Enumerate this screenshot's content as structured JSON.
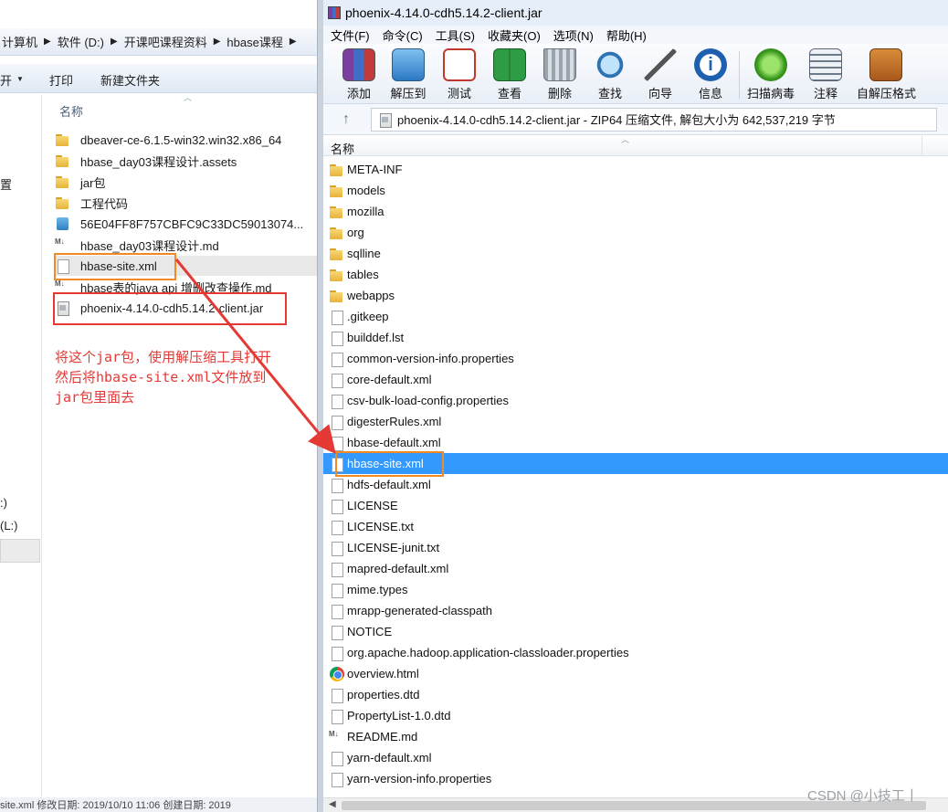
{
  "explorer": {
    "breadcrumbs": [
      "计算机",
      "软件 (D:)",
      "开课吧课程资料",
      "hbase课程"
    ],
    "commands": {
      "open_fragment": "开",
      "print": "打印",
      "new_folder": "新建文件夹"
    },
    "nav": {
      "item_settings": "置",
      "drive_partial_1": ":)",
      "drive_l": "(L:)"
    },
    "column_header": "名称",
    "files": [
      {
        "name": "dbeaver-ce-6.1.5-win32.win32.x86_64",
        "icon": "folder-icon"
      },
      {
        "name": "hbase_day03课程设计.assets",
        "icon": "folder-icon"
      },
      {
        "name": "jar包",
        "icon": "folder-icon"
      },
      {
        "name": "工程代码",
        "icon": "folder-icon"
      },
      {
        "name": "56E04FF8F757CBFC9C33DC59013074...",
        "icon": "image-file-icon"
      },
      {
        "name": "hbase_day03课程设计.md",
        "icon": "markdown-file-icon"
      },
      {
        "name": "hbase-site.xml",
        "icon": "xml-file-icon"
      },
      {
        "name": "hbase表的java api 增删改查操作.md",
        "icon": "markdown-file-icon"
      },
      {
        "name": "phoenix-4.14.0-cdh5.14.2-client.jar",
        "icon": "jar-file-icon"
      }
    ],
    "annotation": [
      "将这个jar包，使用解压缩工具打开",
      "然后将hbase-site.xml文件放到",
      "jar包里面去"
    ],
    "status_bar": "site.xml  修改日期: 2019/10/10 11:06   创建日期: 2019"
  },
  "rar": {
    "title": "phoenix-4.14.0-cdh5.14.2-client.jar",
    "menu": [
      "文件(F)",
      "命令(C)",
      "工具(S)",
      "收藏夹(O)",
      "选项(N)",
      "帮助(H)"
    ],
    "toolbar": [
      {
        "label": "添加",
        "icon": "add-archive-icon"
      },
      {
        "label": "解压到",
        "icon": "extract-to-icon"
      },
      {
        "label": "测试",
        "icon": "test-icon"
      },
      {
        "label": "查看",
        "icon": "view-icon"
      },
      {
        "label": "删除",
        "icon": "delete-icon"
      },
      {
        "label": "查找",
        "icon": "find-icon"
      },
      {
        "label": "向导",
        "icon": "wizard-icon"
      },
      {
        "label": "信息",
        "icon": "info-icon"
      },
      {
        "label": "扫描病毒",
        "icon": "virus-scan-icon"
      },
      {
        "label": "注释",
        "icon": "comment-icon"
      },
      {
        "label": "自解压格式",
        "icon": "sfx-icon"
      }
    ],
    "path": "phoenix-4.14.0-cdh5.14.2-client.jar - ZIP64 压缩文件, 解包大小为 642,537,219 字节",
    "column_header": "名称",
    "entries": [
      {
        "name": "META-INF",
        "icon": "folder-icon"
      },
      {
        "name": "models",
        "icon": "folder-icon"
      },
      {
        "name": "mozilla",
        "icon": "folder-icon"
      },
      {
        "name": "org",
        "icon": "folder-icon"
      },
      {
        "name": "sqlline",
        "icon": "folder-icon"
      },
      {
        "name": "tables",
        "icon": "folder-icon"
      },
      {
        "name": "webapps",
        "icon": "folder-icon"
      },
      {
        "name": ".gitkeep",
        "icon": "file-icon"
      },
      {
        "name": "builddef.lst",
        "icon": "file-icon"
      },
      {
        "name": "common-version-info.properties",
        "icon": "file-icon"
      },
      {
        "name": "core-default.xml",
        "icon": "file-icon"
      },
      {
        "name": "csv-bulk-load-config.properties",
        "icon": "file-icon"
      },
      {
        "name": "digesterRules.xml",
        "icon": "file-icon"
      },
      {
        "name": "hbase-default.xml",
        "icon": "file-icon"
      },
      {
        "name": "hbase-site.xml",
        "icon": "file-icon",
        "selected": true
      },
      {
        "name": "hdfs-default.xml",
        "icon": "file-icon"
      },
      {
        "name": "LICENSE",
        "icon": "file-icon"
      },
      {
        "name": "LICENSE.txt",
        "icon": "file-icon"
      },
      {
        "name": "LICENSE-junit.txt",
        "icon": "file-icon"
      },
      {
        "name": "mapred-default.xml",
        "icon": "file-icon"
      },
      {
        "name": "mime.types",
        "icon": "file-icon"
      },
      {
        "name": "mrapp-generated-classpath",
        "icon": "file-icon"
      },
      {
        "name": "NOTICE",
        "icon": "file-icon"
      },
      {
        "name": "org.apache.hadoop.application-classloader.properties",
        "icon": "file-icon"
      },
      {
        "name": "overview.html",
        "icon": "chrome-html-icon"
      },
      {
        "name": "properties.dtd",
        "icon": "file-icon"
      },
      {
        "name": "PropertyList-1.0.dtd",
        "icon": "file-icon"
      },
      {
        "name": "README.md",
        "icon": "markdown-file-icon"
      },
      {
        "name": "yarn-default.xml",
        "icon": "file-icon"
      },
      {
        "name": "yarn-version-info.properties",
        "icon": "file-icon"
      }
    ],
    "watermark": "CSDN @小技工丨"
  },
  "colors": {
    "selection": "#3399ff",
    "annotation_red": "#e53935",
    "highlight_orange": "#f08a24"
  }
}
